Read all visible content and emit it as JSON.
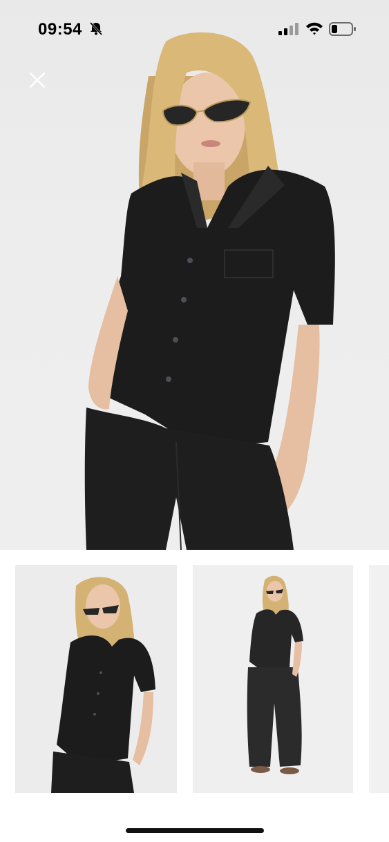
{
  "status_bar": {
    "time": "09:54",
    "icons": [
      "bell-slash-icon",
      "cellular-signal-icon",
      "wifi-icon",
      "battery-low-icon"
    ]
  },
  "gallery": {
    "close_icon": "close-icon",
    "main_image": "model-in-black-shirt-and-trousers-front",
    "thumbnails": [
      {
        "image": "model-front-crop",
        "selected": true
      },
      {
        "image": "model-full-length",
        "selected": false
      },
      {
        "image": "partial-thumbnail",
        "selected": false
      }
    ],
    "selected_border_color": "#d98a4a"
  },
  "colors": {
    "garment": "#1b1b1b",
    "hair": "#d8b777",
    "skin": "#e8c3a8",
    "background": "#eeeeee"
  }
}
